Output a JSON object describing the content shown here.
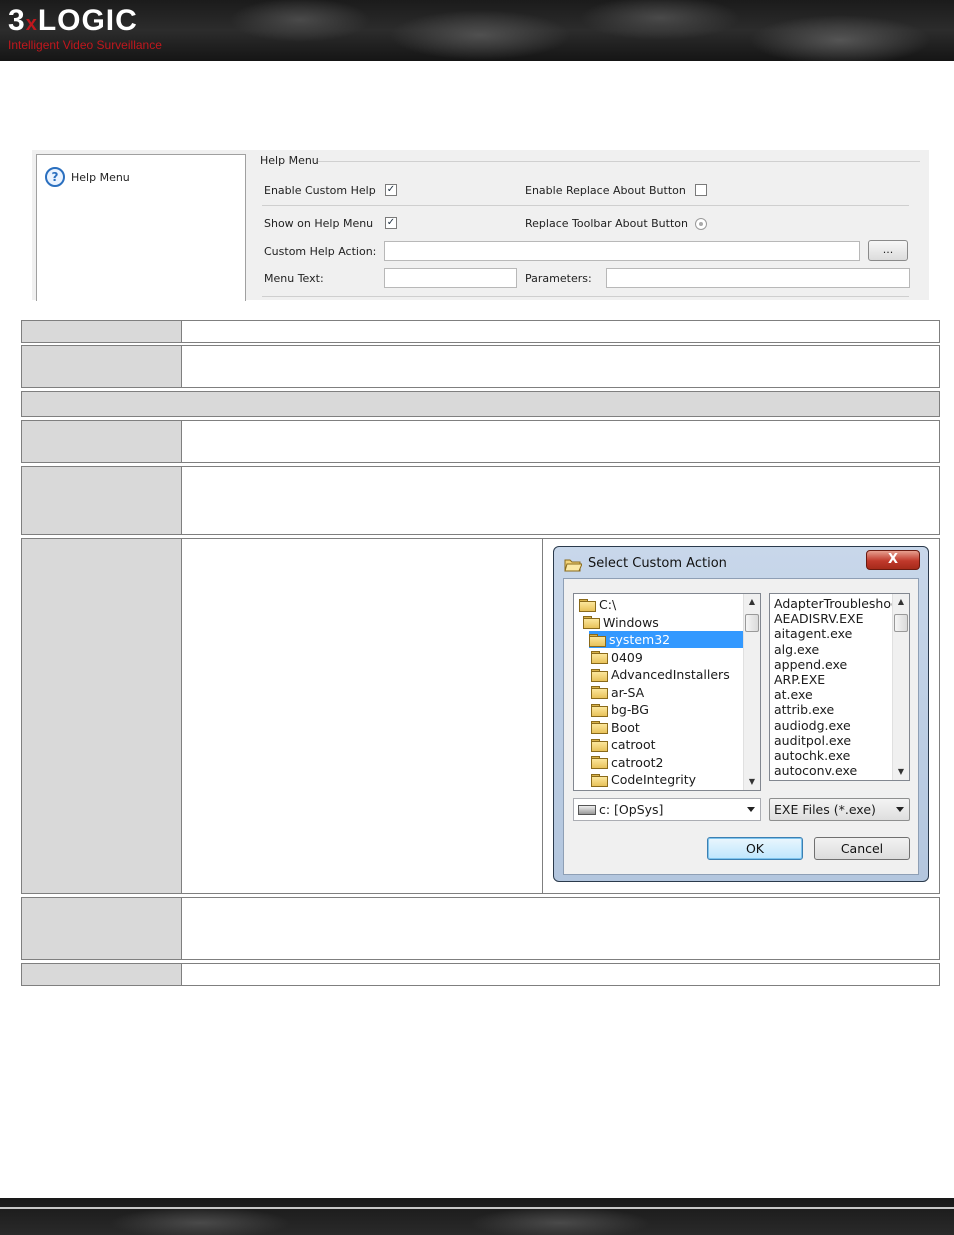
{
  "header": {
    "logo_main": "3",
    "logo_x": "x",
    "logo_rest": "LOGIC",
    "tagline": "Intelligent Video Surveillance",
    "brand_red": "#c0171d"
  },
  "help_panel": {
    "tree_item": "Help Menu",
    "group_title": "Help Menu",
    "enable_custom_help": {
      "label": "Enable Custom Help",
      "checked": true
    },
    "enable_replace_about": {
      "label": "Enable Replace About Button",
      "checked": false
    },
    "show_on_help_menu": {
      "label": "Show on Help Menu",
      "checked": true
    },
    "replace_toolbar_about": {
      "label": "Replace Toolbar About Button"
    },
    "custom_help_action_label": "Custom Help Action:",
    "custom_help_action_value": "",
    "browse_label": "...",
    "menu_text_label": "Menu Text:",
    "menu_text_value": "",
    "parameters_label": "Parameters:",
    "parameters_value": ""
  },
  "dialog": {
    "title": "Select Custom Action",
    "close_label": "X",
    "folders": [
      {
        "name": "C:\\",
        "indent": 0,
        "open": true
      },
      {
        "name": "Windows",
        "indent": 1,
        "open": true
      },
      {
        "name": "system32",
        "indent": 2,
        "open": true,
        "selected": true
      },
      {
        "name": "0409",
        "indent": 3
      },
      {
        "name": "AdvancedInstallers",
        "indent": 3
      },
      {
        "name": "ar-SA",
        "indent": 3
      },
      {
        "name": "bg-BG",
        "indent": 3
      },
      {
        "name": "Boot",
        "indent": 3
      },
      {
        "name": "catroot",
        "indent": 3
      },
      {
        "name": "catroot2",
        "indent": 3
      },
      {
        "name": "CodeIntegrity",
        "indent": 3
      }
    ],
    "files": [
      "AdapterTroubleshoo",
      "AEADISRV.EXE",
      "aitagent.exe",
      "alg.exe",
      "append.exe",
      "ARP.EXE",
      "at.exe",
      "attrib.exe",
      "audiodg.exe",
      "auditpol.exe",
      "autochk.exe",
      "autoconv.exe"
    ],
    "drive_value": "c: [OpSys]",
    "filter_value": "EXE Files (*.exe)",
    "ok_label": "OK",
    "cancel_label": "Cancel"
  }
}
